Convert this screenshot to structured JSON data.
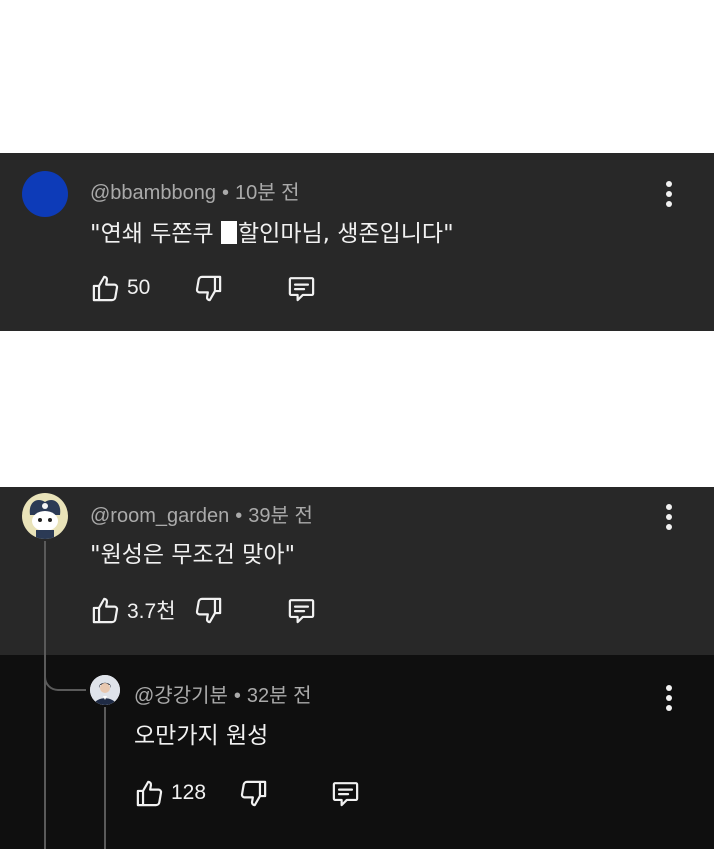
{
  "comments": [
    {
      "handle": "@bbambbong",
      "time": "10분 전",
      "text_before": "\"연쇄 두쫀쿠 ",
      "text_after": "할인마님, 생존입니다\"",
      "likes": "50",
      "avatar_color": "#0d3bb8"
    },
    {
      "handle": "@room_garden",
      "time": "39분 전",
      "text": "\"원성은 무조건 맞아\"",
      "likes": "3.7천",
      "avatar_color": "#e9e3b9"
    },
    {
      "handle": "@걍강기분",
      "time": "32분 전",
      "text": "오만가지 원성",
      "likes": "128",
      "avatar_color": "#dfe3ea"
    }
  ],
  "icons": {
    "like": "thumbs-up-icon",
    "dislike": "thumbs-down-icon",
    "reply": "reply-icon",
    "menu": "more-vert-icon"
  },
  "colors": {
    "panel": "#282828",
    "reply_panel": "#0f0f0f",
    "secondary_text": "#aaaaaa"
  }
}
